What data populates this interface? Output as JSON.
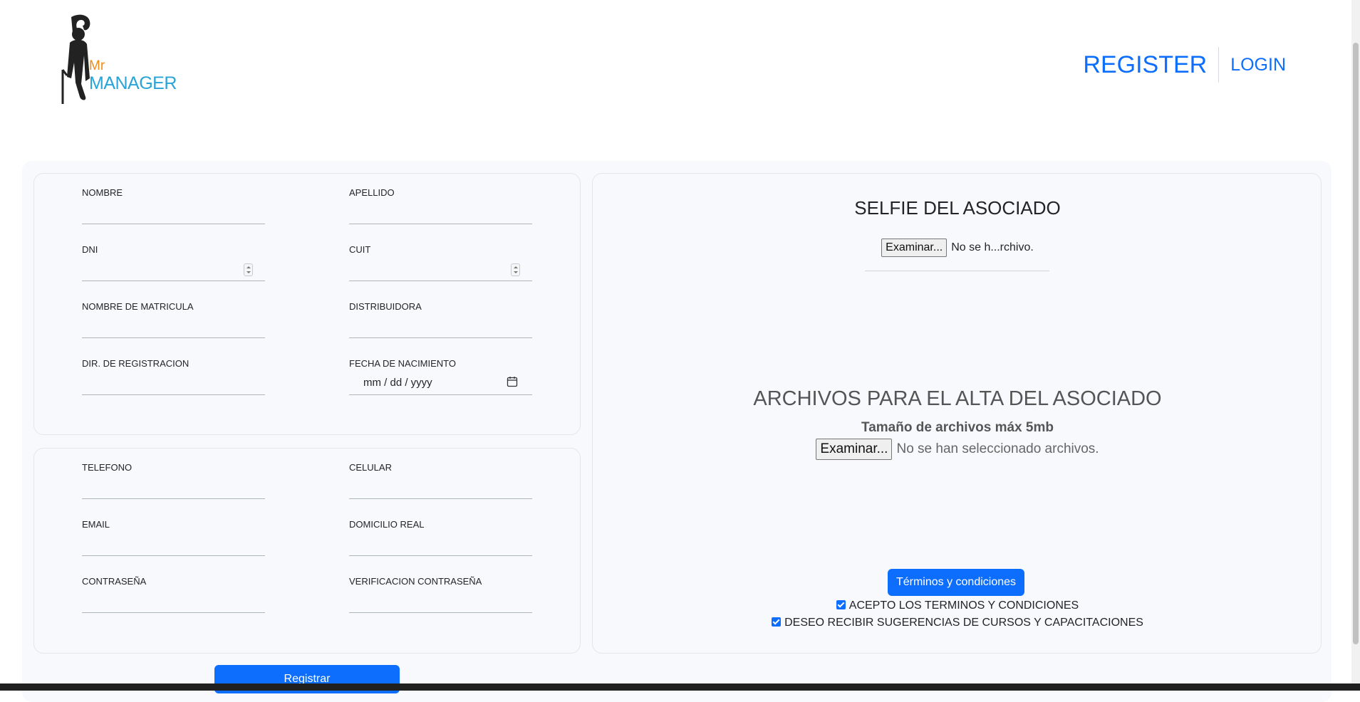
{
  "header": {
    "logo": {
      "mr": "Mr",
      "manager": "MANAGER"
    },
    "nav": {
      "register": "REGISTER",
      "login": "LOGIN"
    }
  },
  "form": {
    "personal": {
      "nombre": "NOMBRE",
      "apellido": "APELLIDO",
      "dni": "DNI",
      "cuit": "CUIT",
      "nombre_matricula": "NOMBRE DE MATRICULA",
      "distribuidora": "DISTRIBUIDORA",
      "dir_registracion": "DIR. DE REGISTRACION",
      "fecha_nacimiento": "FECHA DE NACIMIENTO",
      "fecha_placeholder": "mm / dd / yyyy"
    },
    "contact": {
      "telefono": "TELEFONO",
      "celular": "CELULAR",
      "email": "EMAIL",
      "domicilio": "DOMICILIO REAL",
      "contrasena": "CONTRASEÑA",
      "verificacion": "VERIFICACION CONTRASEÑA"
    },
    "submit_label": "Registrar"
  },
  "files": {
    "selfie_title": "SELFIE DEL ASOCIADO",
    "selfie_button": "Examinar...",
    "selfie_status": "No se h...rchivo.",
    "alta_title": "ARCHIVOS PARA EL ALTA DEL ASOCIADO",
    "alta_subtitle": "Tamaño de archivos máx 5mb",
    "alta_button": "Examinar...",
    "alta_status": "No se han seleccionado archivos.",
    "terms_button": "Términos y condiciones",
    "accept_terms": {
      "label": "ACEPTO LOS TERMINOS Y CONDICIONES",
      "checked": true
    },
    "suggestions": {
      "label": "DESEO RECIBIR SUGERENCIAS DE CURSOS Y CAPACITACIONES",
      "checked": true
    }
  },
  "icons": [
    "calendar-icon",
    "stepper-icon",
    "logo-figure-icon"
  ],
  "colors": {
    "primary": "#0d6efd",
    "logo_orange": "#f08c1a",
    "logo_blue": "#2aa4d6",
    "panel_bg": "#f8f9fc"
  }
}
